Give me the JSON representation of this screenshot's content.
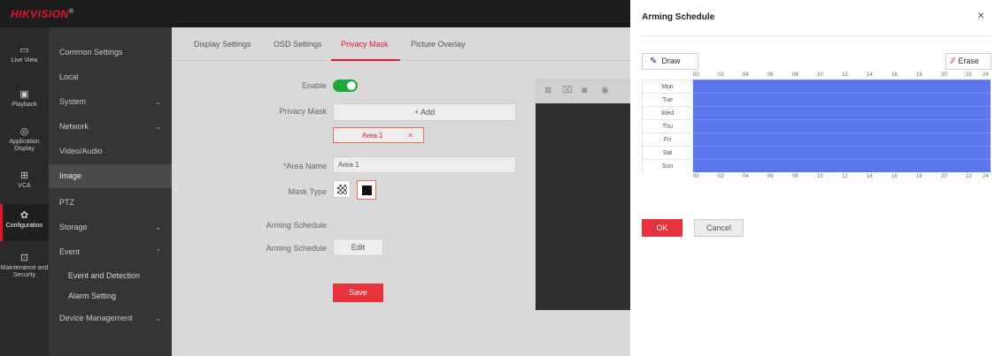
{
  "brand": {
    "name": "HIKVISION",
    "mark": "®"
  },
  "rail": [
    {
      "icon": "monitor-icon",
      "glyph": "▭",
      "label": "Live View"
    },
    {
      "icon": "play-icon",
      "glyph": "▣",
      "label": "Playback"
    },
    {
      "icon": "application-icon",
      "glyph": "◎",
      "label": "Application Display"
    },
    {
      "icon": "grid-icon",
      "glyph": "⊞",
      "label": "VCA"
    },
    {
      "icon": "gear-icon",
      "glyph": "✿",
      "label": "Configuration"
    },
    {
      "icon": "maintenance-icon",
      "glyph": "⊡",
      "label": "Maintenance and Security"
    }
  ],
  "menu": [
    {
      "label": "Common Settings",
      "chevron": ""
    },
    {
      "label": "Local",
      "chevron": ""
    },
    {
      "label": "System",
      "chevron": "⌄"
    },
    {
      "label": "Network",
      "chevron": "⌄"
    },
    {
      "label": "Video/Audio",
      "chevron": ""
    },
    {
      "label": "Image",
      "chevron": ""
    },
    {
      "label": "PTZ",
      "chevron": ""
    },
    {
      "label": "Storage",
      "chevron": "⌄"
    },
    {
      "label": "Event",
      "chevron": "⌃"
    },
    {
      "label": "Event and Detection",
      "chevron": ""
    },
    {
      "label": "Alarm Setting",
      "chevron": ""
    },
    {
      "label": "Device Management",
      "chevron": "⌄"
    }
  ],
  "tabs": [
    "Display Settings",
    "OSD Settings",
    "Privacy Mask",
    "Picture Overlay"
  ],
  "form": {
    "enable_label": "Enable",
    "privacy_mask_label": "Privacy Mask",
    "add_label": "+ Add",
    "area_tag": "Area 1",
    "area_tag_close": "×",
    "area_name_label": "*Area Name",
    "area_name_value": "Area 1",
    "mask_type_label": "Mask Type",
    "arming_header": "Arming Schedule",
    "arming_label": "Arming Schedule",
    "edit_label": "Edit",
    "save_label": "Save"
  },
  "dialog": {
    "title": "Arming Schedule",
    "close": "×",
    "draw_label": "Draw",
    "erase_label": "Erase",
    "days": [
      "Mon",
      "Tue",
      "Wed",
      "Thu",
      "Fri",
      "Sat",
      "Sun"
    ],
    "ticks": [
      "00",
      "02",
      "04",
      "06",
      "08",
      "10",
      "12",
      "14",
      "16",
      "18",
      "20",
      "22",
      "24"
    ],
    "ok_label": "OK",
    "cancel_label": "Cancel",
    "schedule_color": "#5b76ec"
  },
  "colors": {
    "accent": "#e0162b",
    "toggle_on": "#1fa83a"
  }
}
